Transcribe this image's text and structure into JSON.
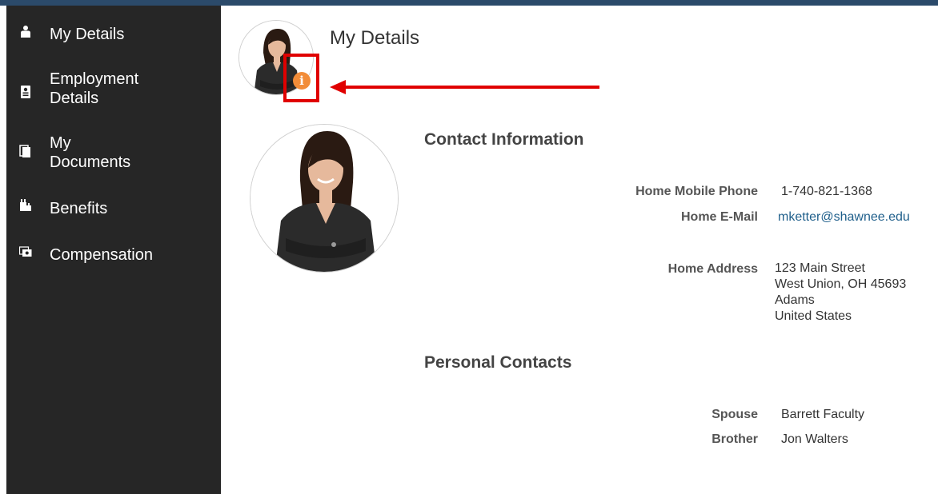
{
  "nav": {
    "items": [
      {
        "label": "My Details",
        "icon": "person-icon"
      },
      {
        "label": "Employment\nDetails",
        "icon": "badge-icon"
      },
      {
        "label": "My\nDocuments",
        "icon": "documents-icon"
      },
      {
        "label": "Benefits",
        "icon": "benefits-icon"
      },
      {
        "label": "Compensation",
        "icon": "compensation-icon"
      }
    ]
  },
  "header": {
    "title": "My Details",
    "info_badge": "i"
  },
  "contact": {
    "section_title": "Contact Information",
    "mobile_label": "Home Mobile Phone",
    "mobile_value": "1-740-821-1368",
    "email_label": "Home E-Mail",
    "email_value": "mketter@shawnee.edu",
    "address_label": "Home Address",
    "address_lines": [
      "123 Main Street",
      "West Union, OH 45693",
      "Adams",
      "United States"
    ]
  },
  "personal_contacts": {
    "section_title": "Personal Contacts",
    "items": [
      {
        "relation": "Spouse",
        "name": "Barrett Faculty"
      },
      {
        "relation": "Brother",
        "name": "Jon Walters"
      }
    ]
  },
  "colors": {
    "sidebar_bg": "#262626",
    "accent_border": "#2b4a6a",
    "info_badge": "#f28c38",
    "annotation_red": "#e00000",
    "link": "#1f5f8b"
  }
}
